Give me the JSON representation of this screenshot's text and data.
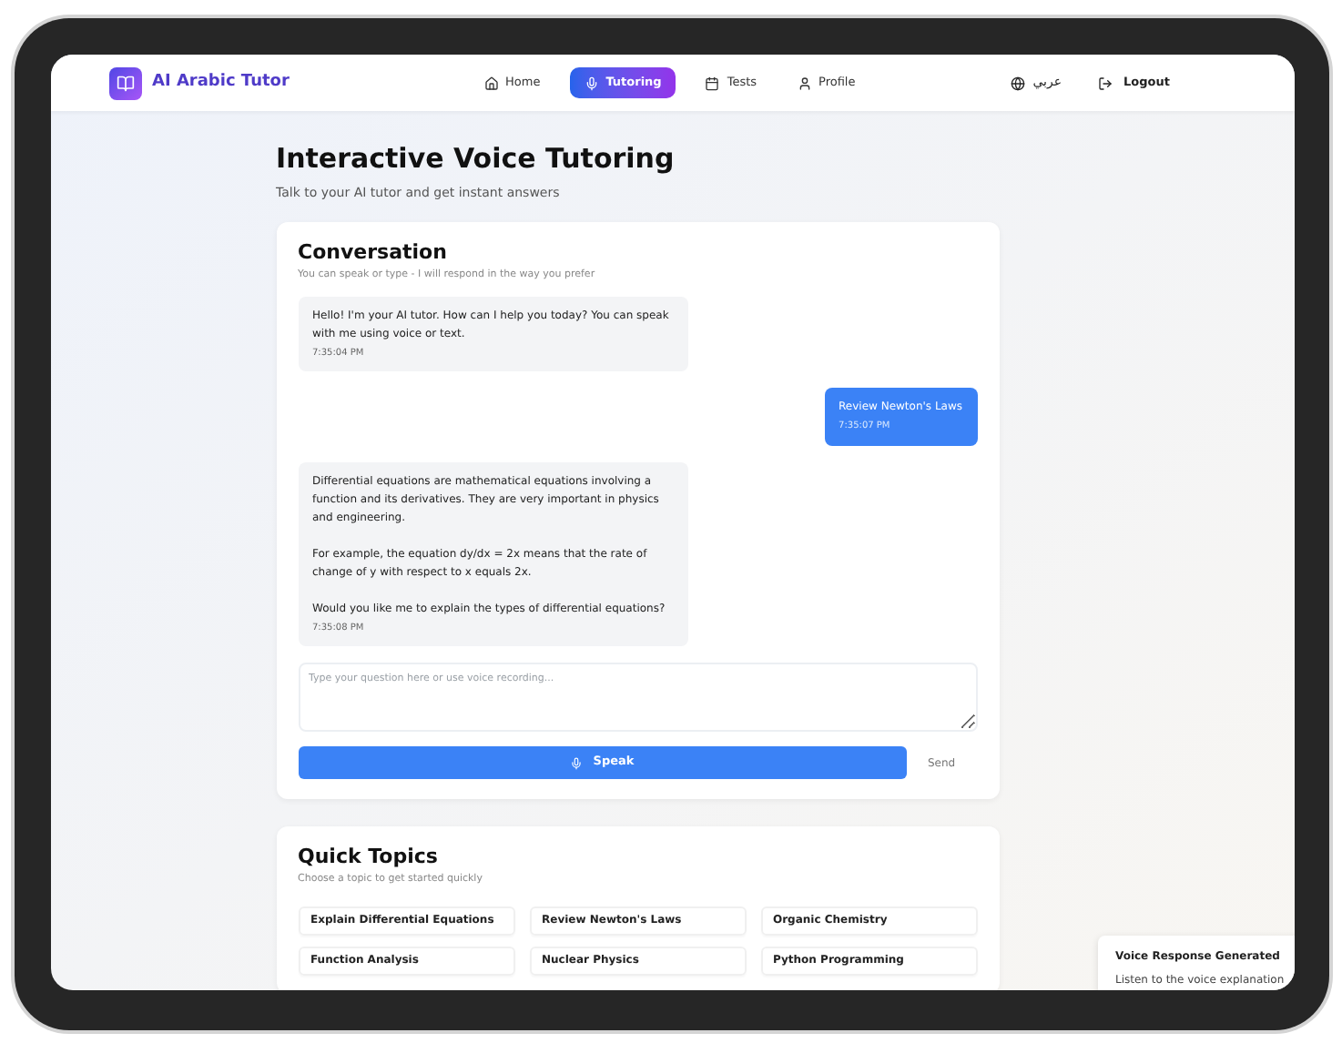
{
  "nav": {
    "brand": "AI Arabic Tutor",
    "items": [
      {
        "label": "Home",
        "kind": "home",
        "selected": false
      },
      {
        "label": "Tutoring",
        "kind": "voice",
        "selected": true
      },
      {
        "label": "Tests",
        "kind": "tests",
        "selected": false
      },
      {
        "label": "Profile",
        "kind": "profile",
        "selected": false
      }
    ],
    "language": "عربي",
    "logout": "Logout"
  },
  "page": {
    "title": "Interactive Voice Tutoring",
    "subtitle": "Talk to your AI tutor and get instant answers"
  },
  "conversation": {
    "title": "Conversation",
    "subtitle": "You can speak or type - I will respond in the way you prefer",
    "messages": [
      {
        "kind": "bot",
        "paragraphs": [
          "Hello! I'm your AI tutor. How can I help you today? You can speak with me using voice or text."
        ],
        "time": "7:35:04 PM"
      },
      {
        "kind": "user",
        "paragraphs": [
          "Review Newton's Laws"
        ],
        "time": "7:35:07 PM"
      },
      {
        "kind": "bot",
        "paragraphs": [
          "Differential equations are mathematical equations involving a function and its derivatives. They are very important in physics and engineering.",
          "For example, the equation dy/dx = 2x means that the rate of change of y with respect to x equals 2x.",
          "Would you like me to explain the types of differential equations?"
        ],
        "time": "7:35:08 PM"
      }
    ],
    "input_placeholder": "Type your question here or use voice recording...",
    "speak": "Speak",
    "send": "Send"
  },
  "quick_topics": {
    "title": "Quick Topics",
    "subtitle": "Choose a topic to get started quickly",
    "topics": [
      "Explain Differential Equations",
      "Review Newton's Laws",
      "Organic Chemistry",
      "Function Analysis",
      "Nuclear Physics",
      "Python Programming"
    ]
  },
  "toast": {
    "title": "Voice Response Generated",
    "text": "Listen to the voice explanation"
  }
}
